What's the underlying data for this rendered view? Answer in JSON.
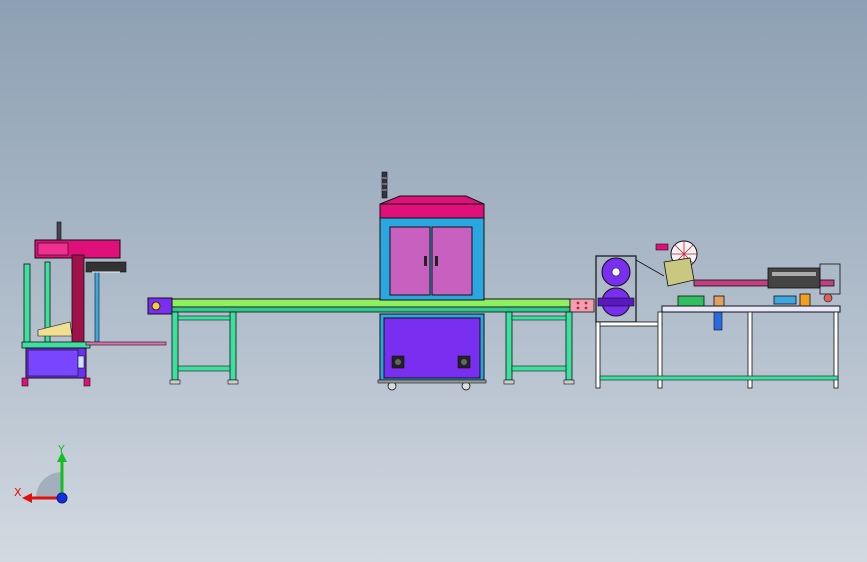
{
  "viewport": {
    "background": "#a3b3c3"
  },
  "triad": {
    "x_label": "X",
    "y_label": "Y",
    "x_color": "#e01010",
    "y_color": "#10c020",
    "z_color": "#1030e0"
  },
  "colors": {
    "outline": "#111111",
    "frame_green": "#3ee0a0",
    "magenta": "#e0107a",
    "purple": "#7a2ff0",
    "blue_frame": "#2aa6e0",
    "pink_door": "#c860c0",
    "conveyor_belt": "#8ff060",
    "purple_dark": "#6020c0"
  }
}
